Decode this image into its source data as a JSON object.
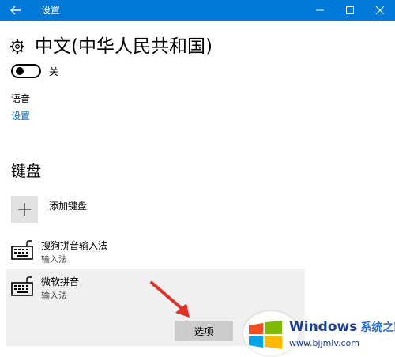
{
  "window": {
    "title": "设置",
    "minimize": "—",
    "maximize": "☐",
    "close": "✕"
  },
  "page": {
    "title": "中文(中华人民共和国)"
  },
  "toggle": {
    "label": "关"
  },
  "speech": {
    "label": "语音",
    "link": "设置"
  },
  "keyboards": {
    "heading": "键盘",
    "add_label": "添加键盘",
    "items": [
      {
        "name": "搜狗拼音输入法",
        "sub": "输入法"
      },
      {
        "name": "微软拼音",
        "sub": "输入法"
      }
    ],
    "options_button": "选项"
  },
  "watermark": {
    "brand": "Windows",
    "brand_cn": "系统之家",
    "url": "www.bjjmlv.com"
  },
  "colors": {
    "titlebar": "#0078d7",
    "link": "#0067b8",
    "selected_item_bg": "#f0f0f0",
    "button_bg": "#cccccc",
    "arrow": "#e0302a"
  }
}
